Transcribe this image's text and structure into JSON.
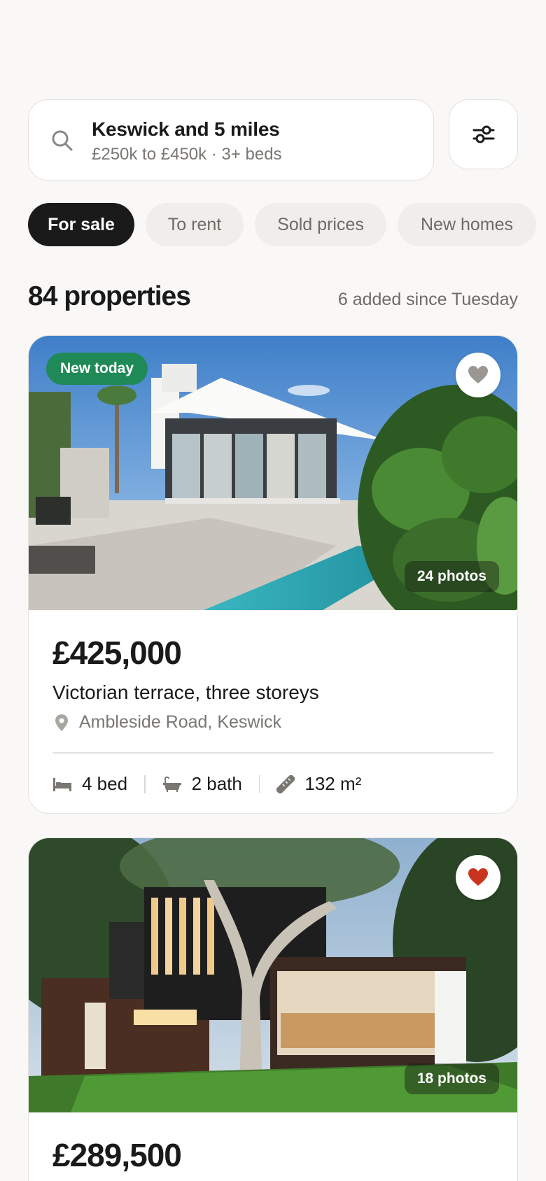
{
  "search": {
    "location": "Keswick and 5 miles",
    "criteria": "£250k to £450k · 3+ beds",
    "search_icon": "search-icon",
    "filter_icon": "sliders-icon"
  },
  "tabs": [
    {
      "label": "For sale",
      "active": true
    },
    {
      "label": "To rent",
      "active": false
    },
    {
      "label": "Sold prices",
      "active": false
    },
    {
      "label": "New homes",
      "active": false
    }
  ],
  "results": {
    "count": "84 properties",
    "new_since": "6 added since Tuesday"
  },
  "listings": [
    {
      "badge": "New today",
      "favorited": false,
      "photos": "24 photos",
      "price": "£425,000",
      "title": "Victorian terrace, three storeys",
      "address": "Ambleside Road, Keswick",
      "beds": "4 bed",
      "baths": "2 bath",
      "area": "132 m²"
    },
    {
      "favorited": true,
      "photos": "18 photos",
      "price": "£289,500"
    }
  ],
  "colors": {
    "accent_green": "#1f8a57",
    "favorite_red": "#c9341f",
    "dark": "#1a1a1a"
  }
}
